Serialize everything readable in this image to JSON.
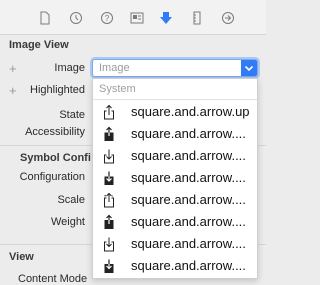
{
  "toolbar": {
    "icons": [
      "file-icon",
      "history-icon",
      "help-icon",
      "identity-icon",
      "attributes-inspector-icon",
      "size-inspector-icon",
      "connections-icon"
    ],
    "selected": "attributes-inspector-icon",
    "accent": "#2f7cf6"
  },
  "image_view": {
    "title": "Image View",
    "image_label": "Image",
    "image_placeholder": "Image",
    "highlighted_label": "Highlighted",
    "state_label": "State",
    "accessibility_label": "Accessibility"
  },
  "symbol_config": {
    "title": "Symbol Confi",
    "configuration_label": "Configuration",
    "scale_label": "Scale",
    "weight_label": "Weight"
  },
  "view": {
    "title": "View",
    "content_mode_label": "Content Mode"
  },
  "dropdown": {
    "header": "System",
    "items": [
      {
        "icon": "square-and-arrow-up-icon",
        "label": "square.and.arrow.up"
      },
      {
        "icon": "square-and-arrow-up-fill-icon",
        "label": "square.and.arrow...."
      },
      {
        "icon": "square-and-arrow-down-icon",
        "label": "square.and.arrow...."
      },
      {
        "icon": "square-and-arrow-down-fill-icon",
        "label": "square.and.arrow...."
      },
      {
        "icon": "square-and-arrow-up-on-square-icon",
        "label": "square.and.arrow...."
      },
      {
        "icon": "square-and-arrow-up-on-square-fill-icon",
        "label": "square.and.arrow...."
      },
      {
        "icon": "square-and-arrow-down-on-square-icon",
        "label": "square.and.arrow...."
      },
      {
        "icon": "square-and-arrow-down-on-square-fill-icon",
        "label": "square.and.arrow...."
      }
    ]
  }
}
